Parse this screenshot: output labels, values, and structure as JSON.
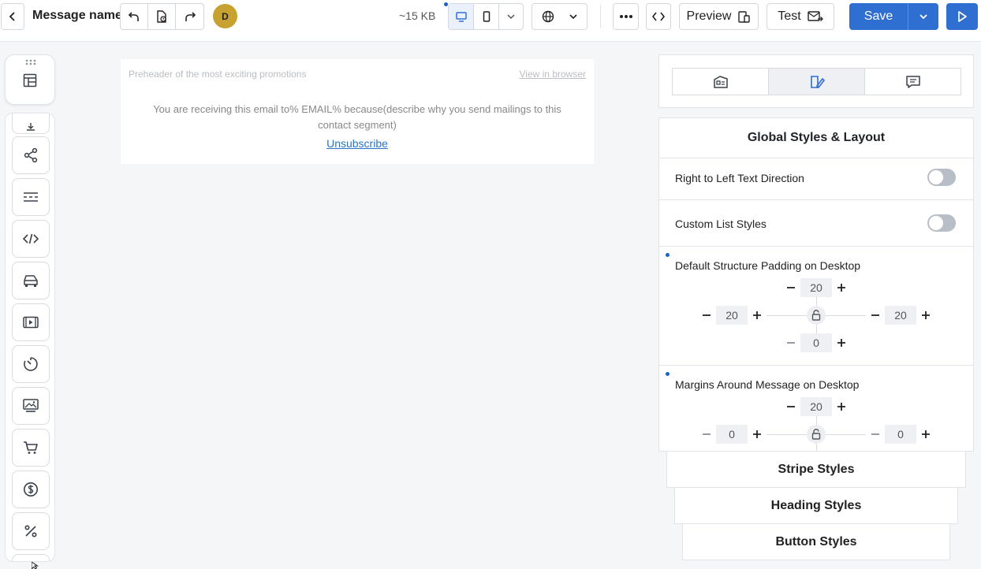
{
  "toolbar": {
    "message_name": "Message name",
    "avatar_initial": "D",
    "size": "~15 KB",
    "preview_label": "Preview",
    "test_label": "Test",
    "save_label": "Save"
  },
  "email": {
    "preheader": "Preheader of the most exciting promotions",
    "view_in_browser": "View in browser",
    "receiving": "You are receiving this email to% EMAIL% because(describe why you send mailings to this contact segment)",
    "unsubscribe": "Unsubscribe"
  },
  "panel": {
    "title": "Global Styles & Layout",
    "rtl_label": "Right to Left Text Direction",
    "rtl_on": false,
    "list_label": "Custom List Styles",
    "list_on": false,
    "padding": {
      "label": "Default Structure Padding on Desktop",
      "top": "20",
      "left": "20",
      "right": "20",
      "bottom": "0"
    },
    "margins": {
      "label": "Margins Around Message on Desktop",
      "top": "20",
      "left": "0",
      "right": "0"
    },
    "sections": [
      "Stripe Styles",
      "Heading Styles",
      "Button Styles"
    ]
  },
  "colors": {
    "accent": "#2f6fd1",
    "avatar": "#c7a230"
  }
}
